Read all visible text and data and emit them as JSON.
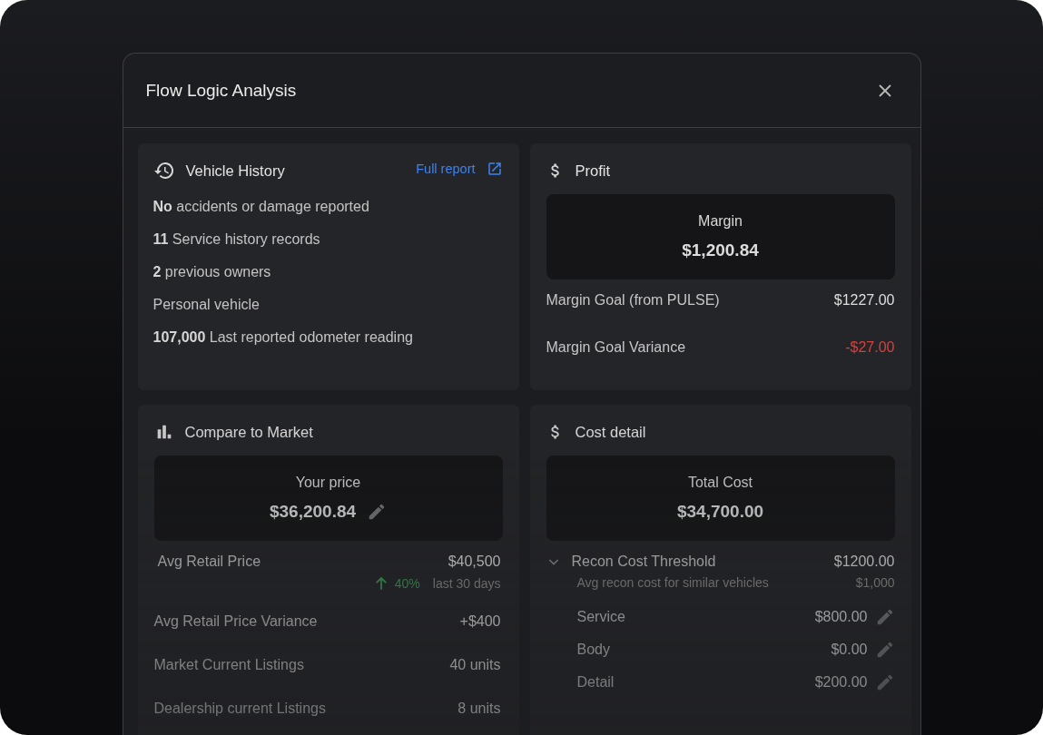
{
  "dialog": {
    "title": "Flow Logic Analysis"
  },
  "vehicle_history": {
    "title": "Vehicle History",
    "link": "Full report",
    "lines": [
      {
        "text": "**No** accidents or damage reported"
      },
      {
        "text": "**11** Service history records"
      },
      {
        "text": "**2** previous owners"
      },
      {
        "text": "Personal vehicle"
      },
      {
        "text": "**107,000** Last reported odometer reading"
      }
    ]
  },
  "profit": {
    "title": "Profit",
    "highlight": {
      "label": "Margin",
      "value": "$1,200.84",
      "editable": false
    },
    "rows": [
      {
        "label": "Margin Goal (from PULSE)",
        "value": "$1227.00",
        "negative": false
      },
      {
        "label": "Margin Goal Variance",
        "value": "-$27.00",
        "negative": true
      }
    ]
  },
  "compare_to_market": {
    "title": "Compare to Market",
    "highlight": {
      "label": "Your price",
      "value": "$36,200.84",
      "editable": true
    },
    "rows": [
      {
        "label": "Avg Retail Price",
        "value": "$40,500",
        "trend": {
          "rising": true,
          "change": "40%",
          "period": "last 30 days"
        }
      },
      {
        "label": "Avg Retail Price Variance",
        "value": "+$400"
      },
      {
        "label": "Market Current Listings",
        "value": "40 units"
      },
      {
        "label": "Dealership current Listings",
        "value": "8 units"
      }
    ]
  },
  "cost_detail": {
    "title": "Cost detail",
    "highlight": {
      "label": "Total Cost",
      "value": "$34,700.00",
      "editable": false
    },
    "threshold": {
      "label": "Recon Cost Threshold",
      "value": "$1200.00",
      "expanded": true,
      "note_label": "Avg recon cost for similar vehicles",
      "note_value": "$1,000",
      "items": [
        {
          "label": "Service",
          "value": "$800.00",
          "editable": true
        },
        {
          "label": "Body",
          "value": "$0.00",
          "editable": true
        },
        {
          "label": "Detail",
          "value": "$200.00",
          "editable": true
        }
      ]
    }
  }
}
